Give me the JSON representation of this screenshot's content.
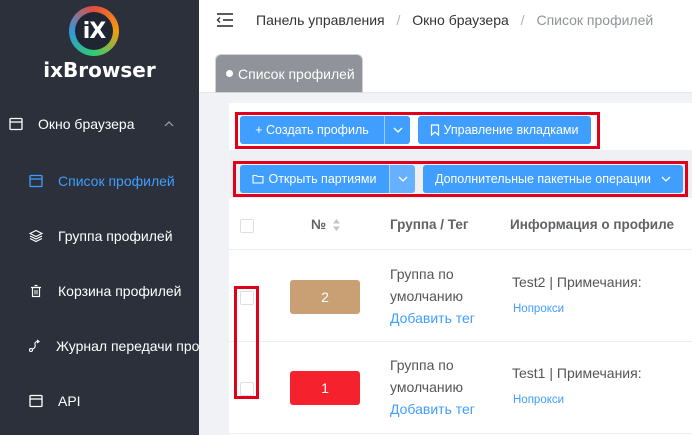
{
  "brand": {
    "logo_text": "iX",
    "name": "ixBrowser"
  },
  "sidebar": {
    "parent": {
      "label": "Окно браузера",
      "icon": "browser-window-icon"
    },
    "items": [
      {
        "label": "Список профилей",
        "icon": "profile-list-icon",
        "active": true
      },
      {
        "label": "Группа профилей",
        "icon": "layers-icon",
        "active": false
      },
      {
        "label": "Корзина профилей",
        "icon": "trash-icon",
        "active": false
      },
      {
        "label": "Журнал передачи профилей",
        "icon": "transfer-icon",
        "active": false
      },
      {
        "label": "API",
        "icon": "api-icon",
        "active": false
      }
    ]
  },
  "breadcrumb": {
    "level1": "Панель управления",
    "sep": "/",
    "level2": "Окно браузера",
    "level3": "Список профилей"
  },
  "tabs": [
    {
      "label": "Список профилей"
    }
  ],
  "toolbar": {
    "create_profile": "+ Создать профиль",
    "manage_tabs": "Управление вкладками",
    "open_batch": "Открыть партиями",
    "batch_ops": "Дополнительные пакетные операции"
  },
  "table": {
    "columns": {
      "number": "№",
      "group_tag": "Группа / Тег",
      "profile_info": "Информация о профиле"
    },
    "rows": [
      {
        "number": "2",
        "badge_color": "#c9a074",
        "group_line1": "Группа по",
        "group_line2": "умолчанию",
        "add_tag": "Добавить тег",
        "info": "Test2 | Примечания:",
        "proxy": "Нопрокси"
      },
      {
        "number": "1",
        "badge_color": "#f5222d",
        "group_line1": "Группа по",
        "group_line2": "умолчанию",
        "add_tag": "Добавить тег",
        "info": "Test1 | Примечания:",
        "proxy": "Нопрокси"
      }
    ]
  },
  "colors": {
    "accent": "#409eff",
    "highlight": "#e0001b",
    "sidebar_bg": "#2b303b"
  }
}
